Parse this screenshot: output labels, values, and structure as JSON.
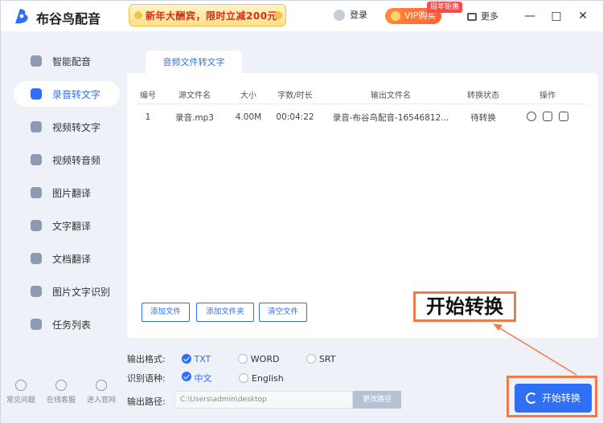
{
  "app": {
    "title": "布谷鸟配音"
  },
  "promo": {
    "text": "新年大酬宾，限时立减200元"
  },
  "header": {
    "login": "登录",
    "vip": "VIP购买",
    "vip_badge": "周年钜惠",
    "more": "更多"
  },
  "sidebar": {
    "items": [
      {
        "label": "智能配音"
      },
      {
        "label": "录音转文字"
      },
      {
        "label": "视频转文字"
      },
      {
        "label": "视频转音频"
      },
      {
        "label": "图片翻译"
      },
      {
        "label": "文字翻译"
      },
      {
        "label": "文档翻译"
      },
      {
        "label": "图片文字识别"
      },
      {
        "label": "任务列表"
      }
    ],
    "bottom": [
      "常见问题",
      "在线客服",
      "进入官网"
    ]
  },
  "main": {
    "tab": "音频文件转文字",
    "columns": [
      "编号",
      "源文件名",
      "大小",
      "字数/时长",
      "输出文件名",
      "转换状态",
      "操作"
    ],
    "rows": [
      {
        "no": "1",
        "name": "录音.mp3",
        "size": "4.00M",
        "duration": "00:04:22",
        "output": "录音-布谷鸟配音-16546812...",
        "status": "待转换"
      }
    ],
    "buttons": {
      "add_file": "添加文件",
      "add_folder": "添加文件夹",
      "clear": "清空文件"
    },
    "format": {
      "label": "输出格式:",
      "options": [
        "TXT",
        "WORD",
        "SRT"
      ]
    },
    "lang": {
      "label": "识别语种:",
      "options": [
        "中文",
        "English"
      ]
    },
    "path": {
      "label": "输出路径:",
      "value": "C:\\Users\\admin\\desktop",
      "button": "更改路径"
    },
    "start": "开始转换"
  },
  "annotation": {
    "text": "开始转换",
    "color": "#f07a4a"
  }
}
